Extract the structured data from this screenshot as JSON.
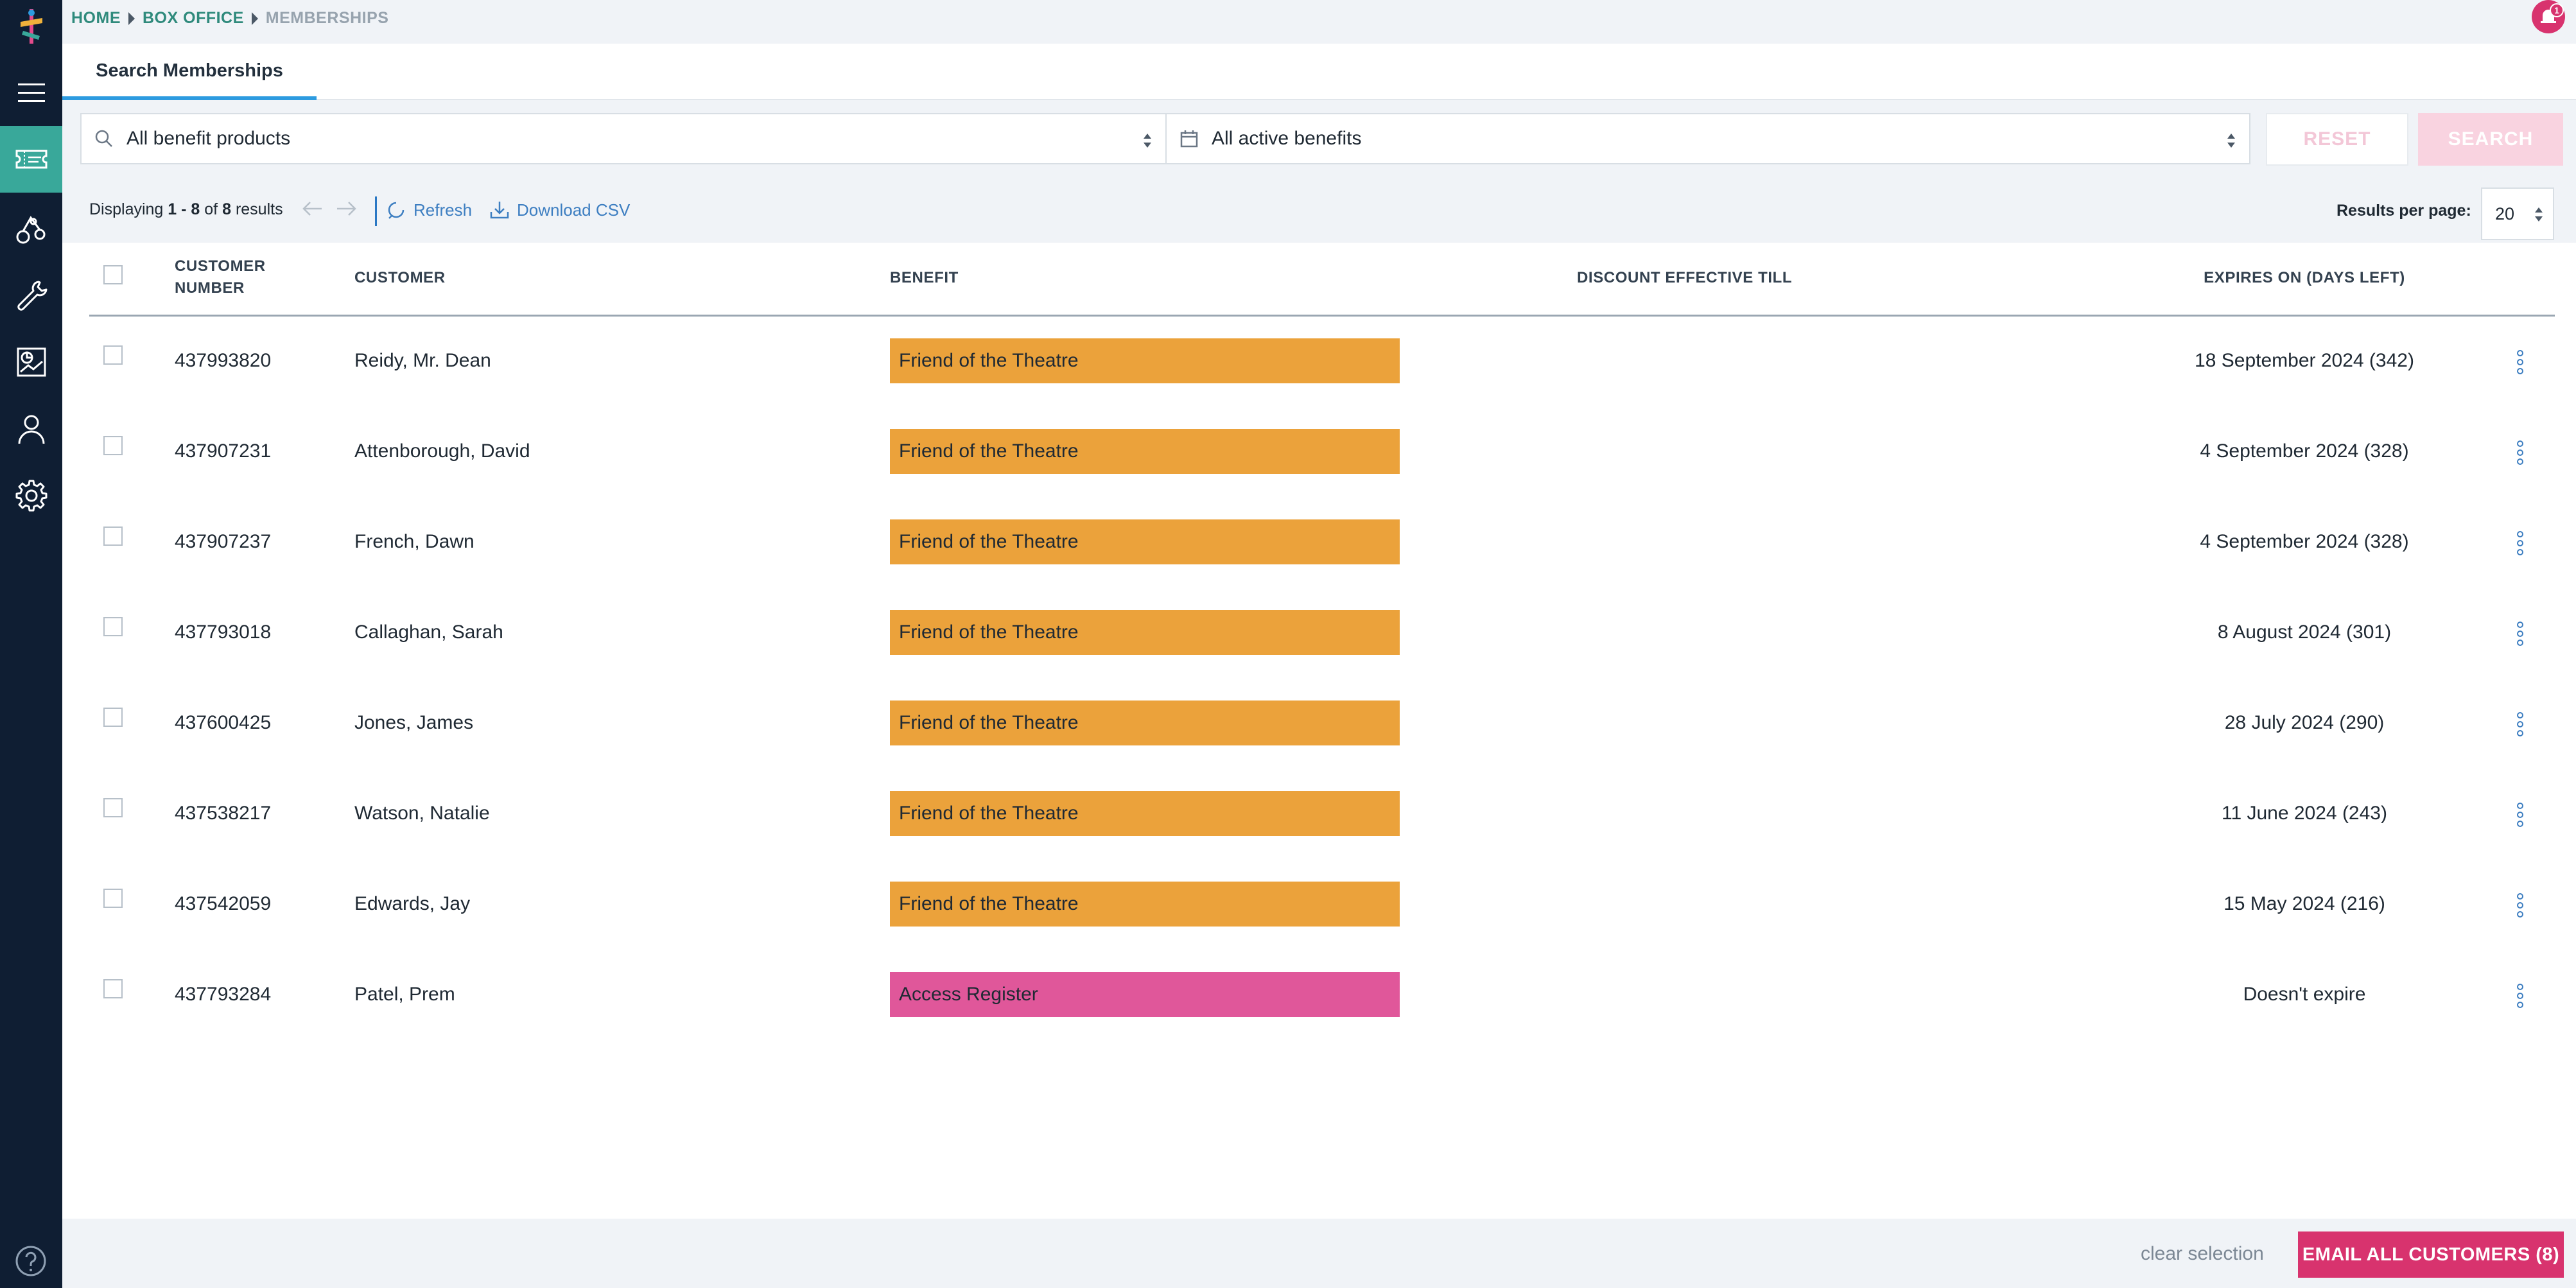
{
  "breadcrumb": {
    "home": "HOME",
    "box_office": "BOX OFFICE",
    "current": "MEMBERSHIPS"
  },
  "notifications": {
    "count": "1"
  },
  "tabs": {
    "active": "Search Memberships"
  },
  "filters": {
    "product": {
      "value": "All benefit products"
    },
    "benefit_status": {
      "value": "All active benefits"
    },
    "reset_label": "RESET",
    "search_label": "SEARCH"
  },
  "results": {
    "displaying_prefix": "Displaying",
    "range": "1 - 8",
    "of_word": "of",
    "total": "8",
    "results_word": "results",
    "refresh_label": "Refresh",
    "download_label": "Download CSV",
    "per_page_label": "Results per page:",
    "per_page_value": "20"
  },
  "table": {
    "columns": {
      "customer_number_line1": "CUSTOMER",
      "customer_number_line2": "NUMBER",
      "customer": "CUSTOMER",
      "benefit": "BENEFIT",
      "discount": "DISCOUNT EFFECTIVE TILL",
      "expires": "EXPIRES ON (DAYS LEFT)"
    },
    "rows": [
      {
        "number": "437993820",
        "customer": "Reidy, Mr. Dean",
        "benefit": "Friend of the Theatre",
        "expires": "18 September 2024 (342)"
      },
      {
        "number": "437907231",
        "customer": "Attenborough, David",
        "benefit": "Friend of the Theatre",
        "expires": "4 September 2024 (328)"
      },
      {
        "number": "437907237",
        "customer": "French, Dawn",
        "benefit": "Friend of the Theatre",
        "expires": "4 September 2024 (328)"
      },
      {
        "number": "437793018",
        "customer": "Callaghan, Sarah",
        "benefit": "Friend of the Theatre",
        "expires": "8 August 2024 (301)"
      },
      {
        "number": "437600425",
        "customer": "Jones, James",
        "benefit": "Friend of the Theatre",
        "expires": "28 July 2024 (290)"
      },
      {
        "number": "437538217",
        "customer": "Watson, Natalie",
        "benefit": "Friend of the Theatre",
        "expires": "11 June 2024 (243)"
      },
      {
        "number": "437542059",
        "customer": "Edwards, Jay",
        "benefit": "Friend of the Theatre",
        "expires": "15 May 2024 (216)"
      },
      {
        "number": "437793284",
        "customer": "Patel, Prem",
        "benefit": "Access Register",
        "expires": "Doesn't expire"
      }
    ]
  },
  "footer": {
    "clear_selection": "clear selection",
    "email_all": "EMAIL ALL CUSTOMERS (8)"
  },
  "colors": {
    "sidebar_bg": "#0f1e33",
    "active_nav": "#39a89a",
    "link": "#2f8a7c",
    "friend_badge": "#eba23b",
    "access_badge": "#e0579a",
    "primary_button": "#d8336e"
  },
  "icons": {
    "sidebar": [
      "menu-icon",
      "ticket-icon",
      "touring-icon",
      "wrench-icon",
      "report-icon",
      "user-icon",
      "settings-icon",
      "help-icon"
    ],
    "filters": [
      "search-icon",
      "calendar-icon"
    ],
    "toolbar": [
      "arrow-left-icon",
      "arrow-right-icon",
      "refresh-icon",
      "download-icon"
    ]
  }
}
